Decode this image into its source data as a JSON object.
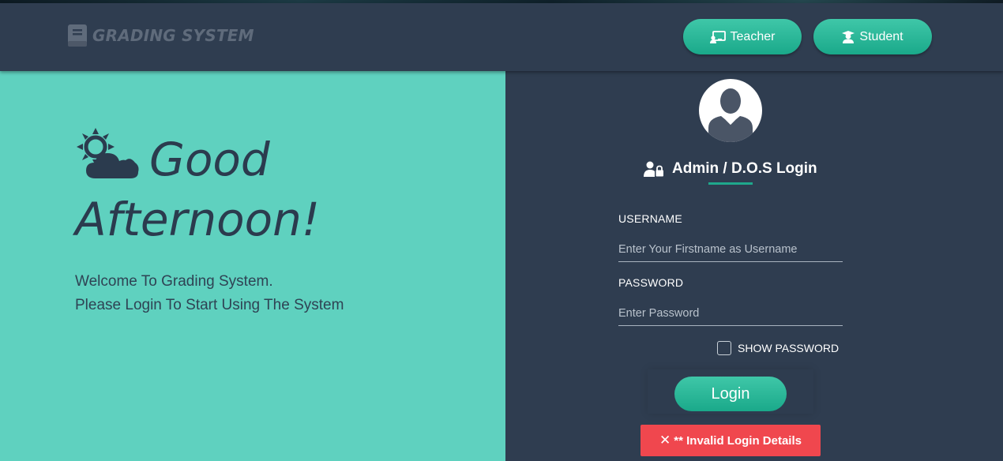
{
  "brand": {
    "icon": "book-icon",
    "word1": "GRADING",
    "word2": "SYSTEM"
  },
  "nav": {
    "teacher": {
      "label": "Teacher",
      "icon": "chalkboard-teacher-icon"
    },
    "student": {
      "label": "Student",
      "icon": "graduate-icon"
    }
  },
  "greeting": {
    "icon": "sun-cloud-icon",
    "line1": "Good",
    "line2": "Afternoon!",
    "welcome1": "Welcome To Grading System.",
    "welcome2": "Please Login To Start Using The System"
  },
  "login": {
    "title": "Admin / D.O.S Login",
    "username_label": "USERNAME",
    "username_placeholder": "Enter Your Firstname as Username",
    "username_value": "",
    "password_label": "PASSWORD",
    "password_placeholder": "Enter Password",
    "password_value": "",
    "show_password_label": "SHOW PASSWORD",
    "show_password_checked": false,
    "button_label": "Login",
    "error": {
      "mark": "✕",
      "text": "** Invalid Login Details"
    }
  },
  "colors": {
    "navbar": "#2f3d50",
    "left_panel": "#5fd1bf",
    "accent": "#1fa88c",
    "error": "#f0474e"
  }
}
